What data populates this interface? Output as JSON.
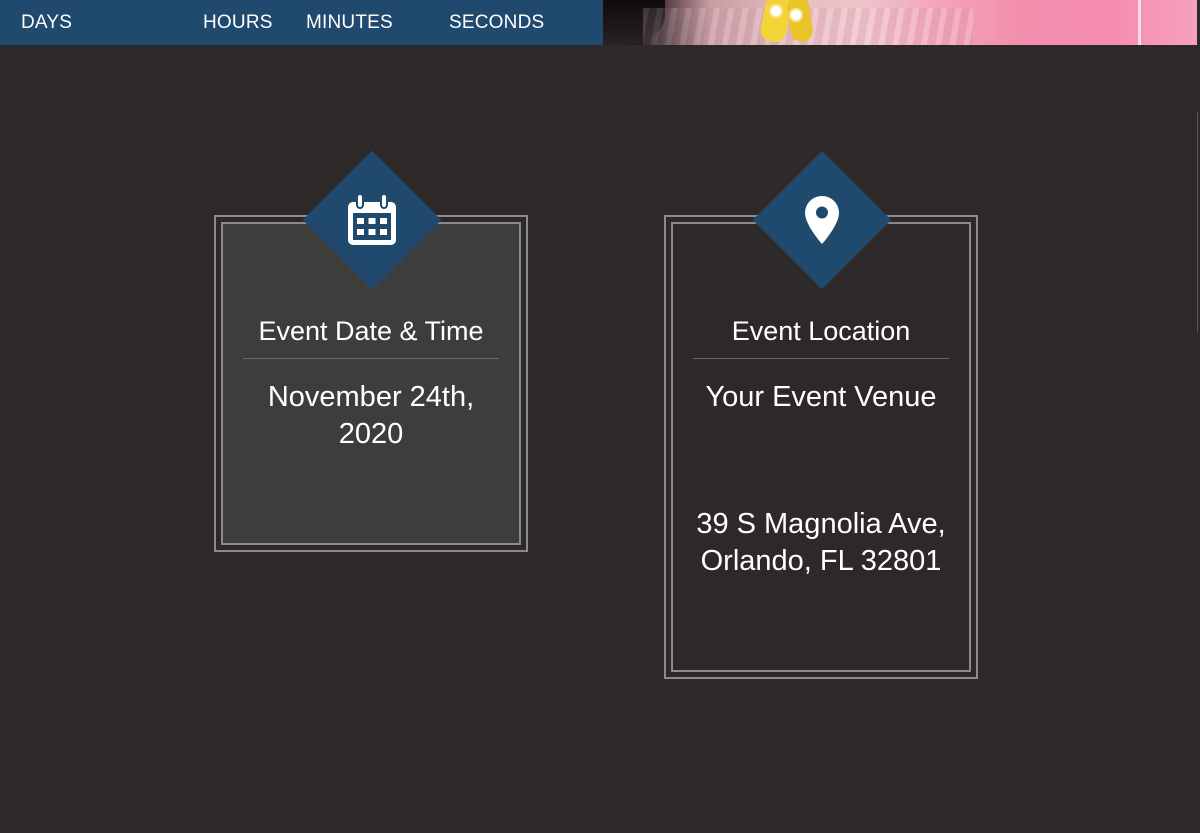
{
  "countdown": {
    "labels": {
      "days": "DAYS",
      "hours": "HOURS",
      "minutes": "MINUTES",
      "seconds": "SECONDS"
    },
    "background_color": "#1f4a6e"
  },
  "date_card": {
    "icon": "calendar-icon",
    "title": "Event Date & Time",
    "date_line1": "November 24th,",
    "date_line2": "2020"
  },
  "location_card": {
    "icon": "map-pin-icon",
    "title": "Event Location",
    "venue": "Your Event Venue",
    "address_line1": "39 S Magnolia Ave,",
    "address_line2": "Orlando, FL 32801"
  },
  "colors": {
    "page_background": "#2d2928",
    "accent": "#1f4a6e",
    "card_fill": "#3d3d3d",
    "border": "#8d8a89",
    "text": "#ffffff"
  }
}
